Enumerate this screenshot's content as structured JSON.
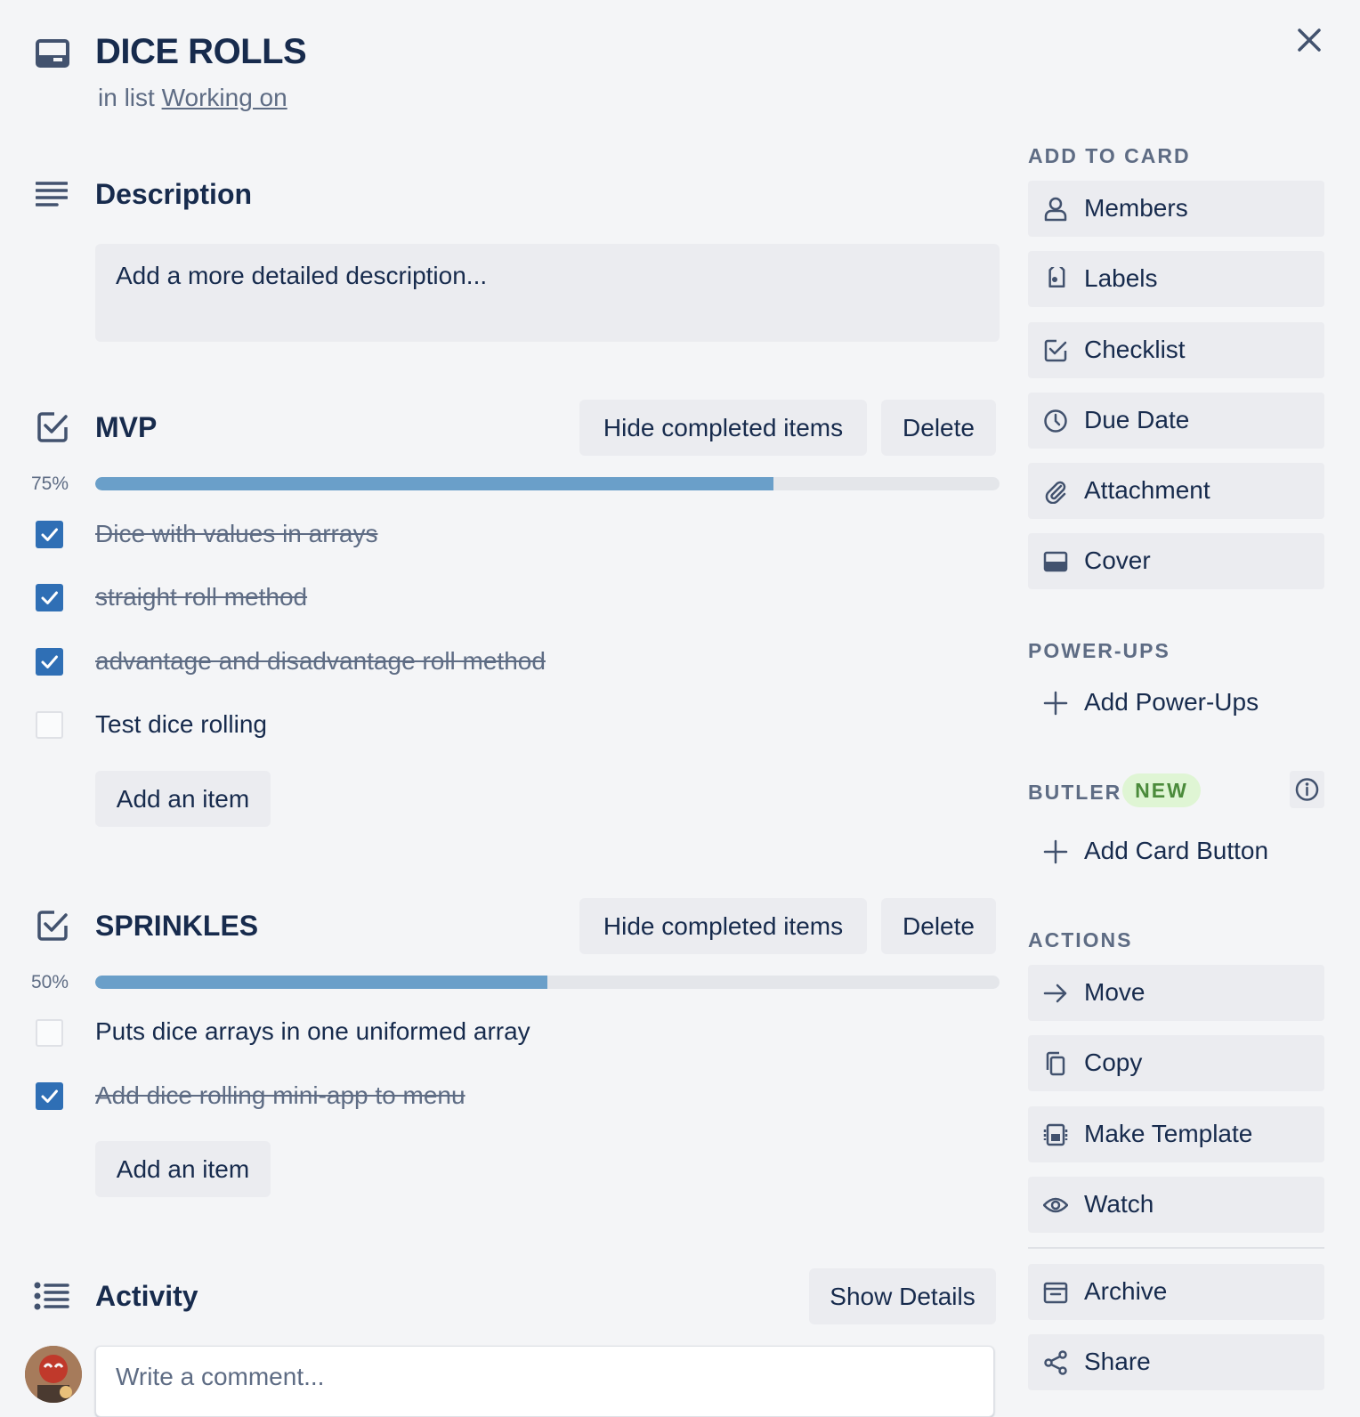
{
  "card": {
    "title": "DICE ROLLS",
    "in_list_prefix": "in list",
    "list_name": "Working on"
  },
  "description": {
    "heading": "Description",
    "placeholder": "Add a more detailed description..."
  },
  "checklists": [
    {
      "title": "MVP",
      "hide_label": "Hide completed items",
      "delete_label": "Delete",
      "percent_label": "75%",
      "progress": 0.75,
      "items": [
        {
          "text": "Dice with values in arrays",
          "checked": true
        },
        {
          "text": "straight roll method",
          "checked": true
        },
        {
          "text": "advantage and disadvantage roll method",
          "checked": true
        },
        {
          "text": "Test dice rolling",
          "checked": false
        }
      ],
      "add_item_label": "Add an item"
    },
    {
      "title": "SPRINKLES",
      "hide_label": "Hide completed items",
      "delete_label": "Delete",
      "percent_label": "50%",
      "progress": 0.5,
      "items": [
        {
          "text": "Puts dice arrays in one uniformed array",
          "checked": false
        },
        {
          "text": "Add dice rolling mini-app to menu",
          "checked": true
        }
      ],
      "add_item_label": "Add an item"
    }
  ],
  "activity": {
    "heading": "Activity",
    "show_details_label": "Show Details",
    "comment_placeholder": "Write a comment..."
  },
  "sidebar": {
    "add_to_card": {
      "label": "ADD TO CARD",
      "items": [
        {
          "label": "Members",
          "icon": "person-icon"
        },
        {
          "label": "Labels",
          "icon": "tag-icon"
        },
        {
          "label": "Checklist",
          "icon": "checklist-icon"
        },
        {
          "label": "Due Date",
          "icon": "clock-icon"
        },
        {
          "label": "Attachment",
          "icon": "paperclip-icon"
        },
        {
          "label": "Cover",
          "icon": "cover-icon"
        }
      ]
    },
    "power_ups": {
      "label": "POWER-UPS",
      "add_label": "Add Power-Ups"
    },
    "butler": {
      "label": "BUTLER",
      "badge": "NEW",
      "add_label": "Add Card Button"
    },
    "actions": {
      "label": "ACTIONS",
      "items": [
        {
          "label": "Move",
          "icon": "arrow-right-icon"
        },
        {
          "label": "Copy",
          "icon": "copy-icon"
        },
        {
          "label": "Make Template",
          "icon": "template-icon"
        },
        {
          "label": "Watch",
          "icon": "eye-icon"
        },
        {
          "label": "Archive",
          "icon": "archive-icon"
        },
        {
          "label": "Share",
          "icon": "share-icon"
        }
      ]
    }
  },
  "colors": {
    "progress_fill": "#6a9fc9",
    "checkbox_checked": "#2f6fb5",
    "badge_bg": "#dff5d4",
    "badge_text": "#4b8b3b"
  }
}
